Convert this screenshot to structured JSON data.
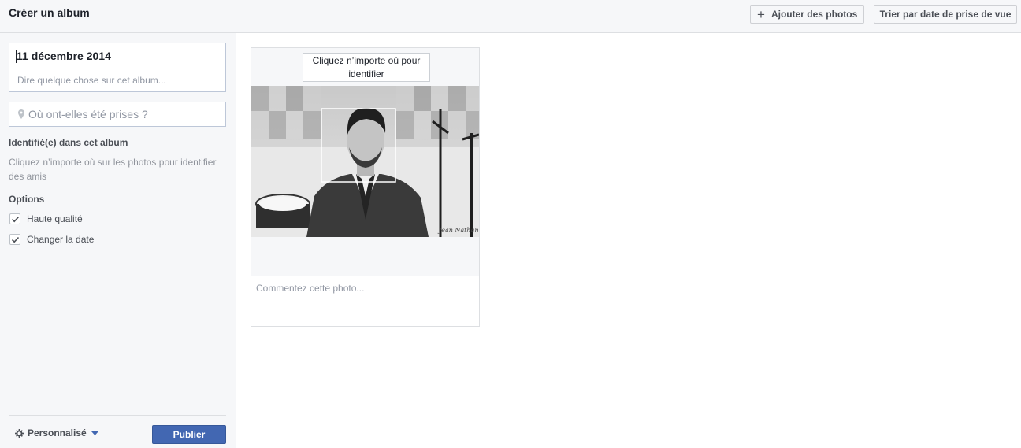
{
  "header": {
    "title": "Créer un album",
    "add_photos_label": "Ajouter des photos",
    "sort_label": "Trier par date de prise de vue"
  },
  "album": {
    "title": "11 décembre 2014",
    "description_placeholder": "Dire quelque chose sur cet album...",
    "location_placeholder": "Où ont-elles été prises ?"
  },
  "tagged": {
    "heading": "Identifié(e) dans cet album",
    "description": "Cliquez n’importe où sur les photos pour identifier des amis"
  },
  "options": {
    "heading": "Options",
    "items": [
      {
        "label": "Haute qualité",
        "checked": true
      },
      {
        "label": "Changer la date",
        "checked": true
      }
    ]
  },
  "footer": {
    "privacy_label": "Personnalisé",
    "publish_label": "Publier"
  },
  "photo": {
    "tag_hint": "Cliquez n’importe où pour identifier",
    "comment_placeholder": "Commentez cette photo...",
    "signature": "Jean Nathan"
  },
  "icons": {
    "add": "plus-icon",
    "location": "map-pin-icon",
    "privacy": "gear-icon",
    "dropdown": "chevron-down-icon",
    "checkbox": "checkmark-icon"
  },
  "colors": {
    "accent": "#4267b2",
    "background": "#f6f7f9",
    "border": "#dddfe2"
  }
}
